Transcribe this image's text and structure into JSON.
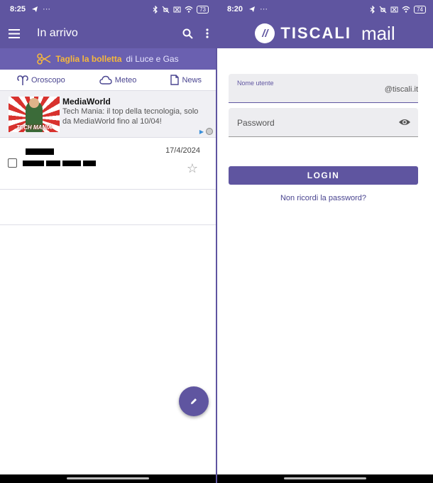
{
  "left_screen": {
    "status": {
      "time": "8:25",
      "battery": "73"
    },
    "appbar": {
      "title": "In arrivo"
    },
    "promo": {
      "highlight": "Taglia la bolletta",
      "rest": "di Luce e Gas"
    },
    "quicklinks": [
      {
        "label": "Oroscopo",
        "icon": "aries-icon"
      },
      {
        "label": "Meteo",
        "icon": "cloud-icon"
      },
      {
        "label": "News",
        "icon": "document-icon"
      }
    ],
    "ad": {
      "brand": "MediaWorld",
      "description": "Tech Mania: il top della tecnologia, solo da MediaWorld fino al 10/04!",
      "thumb_text": "TECH MANIA"
    },
    "email": {
      "date": "17/4/2024"
    }
  },
  "right_screen": {
    "status": {
      "time": "8:20",
      "battery": "74"
    },
    "brand": {
      "mark": "//",
      "word1": "TISCALI",
      "word2": "mail"
    },
    "username": {
      "label": "Nome utente",
      "suffix": "@tiscali.it"
    },
    "password": {
      "placeholder": "Password"
    },
    "login_label": "LOGIN",
    "forgot_label": "Non ricordi la password?"
  },
  "colors": {
    "primary": "#5f55a0",
    "accent": "#f6b73c"
  }
}
